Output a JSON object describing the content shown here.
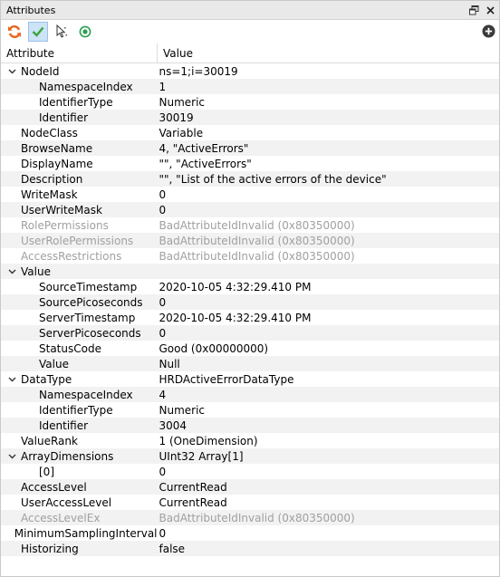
{
  "panel": {
    "title": "Attributes"
  },
  "table": {
    "headers": [
      "Attribute",
      "Value"
    ],
    "rows": [
      {
        "indent": 0,
        "expander": true,
        "name": "NodeId",
        "value": "ns=1;i=30019",
        "grey": false
      },
      {
        "indent": 1,
        "expander": false,
        "name": "NamespaceIndex",
        "value": "1",
        "grey": false
      },
      {
        "indent": 1,
        "expander": false,
        "name": "IdentifierType",
        "value": "Numeric",
        "grey": false
      },
      {
        "indent": 1,
        "expander": false,
        "name": "Identifier",
        "value": "30019",
        "grey": false
      },
      {
        "indent": 0,
        "expander": false,
        "name": "NodeClass",
        "value": "Variable",
        "grey": false
      },
      {
        "indent": 0,
        "expander": false,
        "name": "BrowseName",
        "value": "4, \"ActiveErrors\"",
        "grey": false
      },
      {
        "indent": 0,
        "expander": false,
        "name": "DisplayName",
        "value": "\"\", \"ActiveErrors\"",
        "grey": false
      },
      {
        "indent": 0,
        "expander": false,
        "name": "Description",
        "value": "\"\", \"List of the active errors of the device\"",
        "grey": false
      },
      {
        "indent": 0,
        "expander": false,
        "name": "WriteMask",
        "value": "0",
        "grey": false
      },
      {
        "indent": 0,
        "expander": false,
        "name": "UserWriteMask",
        "value": "0",
        "grey": false
      },
      {
        "indent": 0,
        "expander": false,
        "name": "RolePermissions",
        "value": "BadAttributeIdInvalid (0x80350000)",
        "grey": true
      },
      {
        "indent": 0,
        "expander": false,
        "name": "UserRolePermissions",
        "value": "BadAttributeIdInvalid (0x80350000)",
        "grey": true
      },
      {
        "indent": 0,
        "expander": false,
        "name": "AccessRestrictions",
        "value": "BadAttributeIdInvalid (0x80350000)",
        "grey": true
      },
      {
        "indent": 0,
        "expander": true,
        "name": "Value",
        "value": "",
        "grey": false
      },
      {
        "indent": 1,
        "expander": false,
        "name": "SourceTimestamp",
        "value": "2020-10-05 4:32:29.410 PM",
        "grey": false
      },
      {
        "indent": 1,
        "expander": false,
        "name": "SourcePicoseconds",
        "value": "0",
        "grey": false
      },
      {
        "indent": 1,
        "expander": false,
        "name": "ServerTimestamp",
        "value": "2020-10-05 4:32:29.410 PM",
        "grey": false
      },
      {
        "indent": 1,
        "expander": false,
        "name": "ServerPicoseconds",
        "value": "0",
        "grey": false
      },
      {
        "indent": 1,
        "expander": false,
        "name": "StatusCode",
        "value": "Good (0x00000000)",
        "grey": false
      },
      {
        "indent": 1,
        "expander": false,
        "name": "Value",
        "value": "Null",
        "grey": false
      },
      {
        "indent": 0,
        "expander": true,
        "name": "DataType",
        "value": "HRDActiveErrorDataType",
        "grey": false
      },
      {
        "indent": 1,
        "expander": false,
        "name": "NamespaceIndex",
        "value": "4",
        "grey": false
      },
      {
        "indent": 1,
        "expander": false,
        "name": "IdentifierType",
        "value": "Numeric",
        "grey": false
      },
      {
        "indent": 1,
        "expander": false,
        "name": "Identifier",
        "value": "3004",
        "grey": false
      },
      {
        "indent": 0,
        "expander": false,
        "name": "ValueRank",
        "value": "1 (OneDimension)",
        "grey": false
      },
      {
        "indent": 0,
        "expander": true,
        "name": "ArrayDimensions",
        "value": "UInt32 Array[1]",
        "grey": false
      },
      {
        "indent": 1,
        "expander": false,
        "name": "[0]",
        "value": "0",
        "grey": false
      },
      {
        "indent": 0,
        "expander": false,
        "name": "AccessLevel",
        "value": "CurrentRead",
        "grey": false
      },
      {
        "indent": 0,
        "expander": false,
        "name": "UserAccessLevel",
        "value": "CurrentRead",
        "grey": false
      },
      {
        "indent": 0,
        "expander": false,
        "name": "AccessLevelEx",
        "value": "BadAttributeIdInvalid (0x80350000)",
        "grey": true
      },
      {
        "indent": 0,
        "expander": false,
        "name": "MinimumSamplingInterval",
        "value": "0",
        "grey": false
      },
      {
        "indent": 0,
        "expander": false,
        "name": "Historizing",
        "value": "false",
        "grey": false
      }
    ]
  },
  "colors": {
    "grey_text": "#a0a0a0",
    "alt_row": "#f2f2f2",
    "toolbar_active": "#cde3f7"
  }
}
